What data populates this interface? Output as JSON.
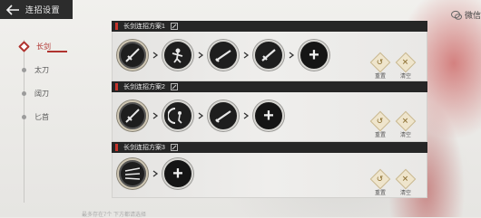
{
  "header": {
    "title": "连招设置"
  },
  "corner": {
    "label": "微信"
  },
  "sidebar": {
    "items": [
      {
        "label": "长剑",
        "active": true
      },
      {
        "label": "太刀",
        "active": false
      },
      {
        "label": "阔刀",
        "active": false
      },
      {
        "label": "匕首",
        "active": false
      }
    ]
  },
  "panels": [
    {
      "title": "长剑连招方案1",
      "reset_label": "重置",
      "clear_label": "清空"
    },
    {
      "title": "长剑连招方案2",
      "reset_label": "重置",
      "clear_label": "清空"
    },
    {
      "title": "长剑连招方案3",
      "reset_label": "重置",
      "clear_label": "清空"
    }
  ],
  "add_symbol": "+",
  "footer": {
    "note": "最多存在7个 下方都请选择"
  },
  "colors": {
    "accent": "#b0332f",
    "header_bg": "#262626"
  }
}
